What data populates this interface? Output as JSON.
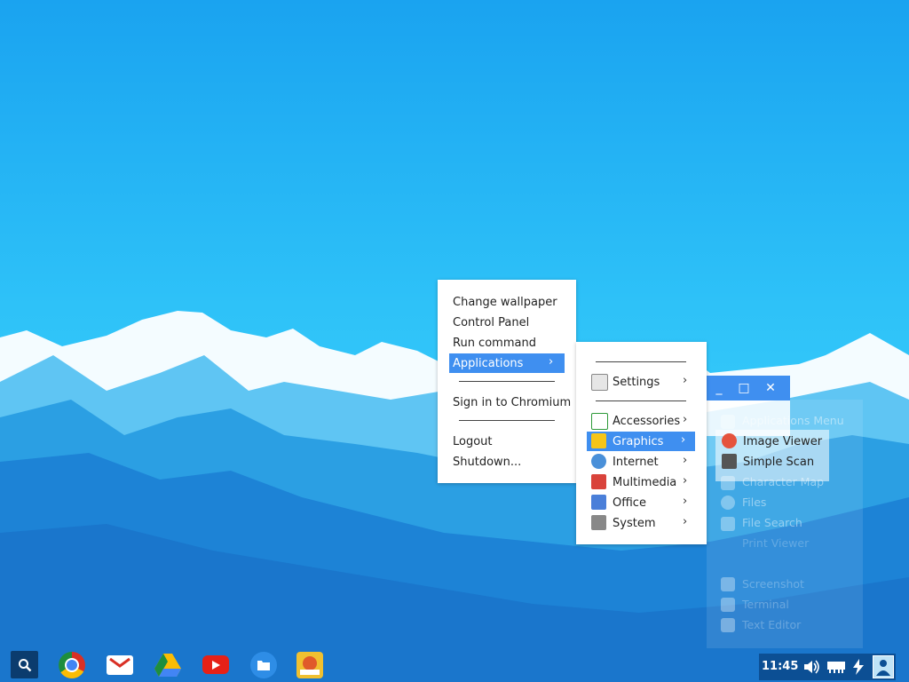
{
  "desktop_menu": {
    "items": [
      {
        "label": "Change wallpaper"
      },
      {
        "label": "Control Panel"
      },
      {
        "label": "Run command"
      },
      {
        "label": "Applications"
      },
      {
        "label": "Sign in to Chromium"
      },
      {
        "label": "Logout"
      },
      {
        "label": "Shutdown..."
      }
    ]
  },
  "applications_menu": {
    "items": [
      {
        "label": "Settings",
        "icon": "settings-icon"
      },
      {
        "label": "Accessories",
        "icon": "accessories-icon"
      },
      {
        "label": "Graphics",
        "icon": "graphics-icon"
      },
      {
        "label": "Internet",
        "icon": "internet-icon"
      },
      {
        "label": "Multimedia",
        "icon": "multimedia-icon"
      },
      {
        "label": "Office",
        "icon": "office-icon"
      },
      {
        "label": "System",
        "icon": "system-icon"
      }
    ]
  },
  "graphics_menu": {
    "items": [
      {
        "label": "Image Viewer",
        "icon": "image-viewer-icon"
      },
      {
        "label": "Simple Scan",
        "icon": "scanner-icon"
      }
    ]
  },
  "background_window": {
    "items": [
      "Applications Menu",
      "Character Map",
      "Files",
      "File Search",
      "Print Viewer",
      "Screenshot",
      "Terminal",
      "Text Editor"
    ]
  },
  "taskbar": {
    "apps": [
      "search-icon",
      "chromium-icon",
      "gmail-icon",
      "drive-icon",
      "youtube-icon",
      "files-icon",
      "game-icon"
    ],
    "clock": "11:45"
  },
  "colors": {
    "accent": "#3f8ff0",
    "sky": "#2ec2f8"
  }
}
